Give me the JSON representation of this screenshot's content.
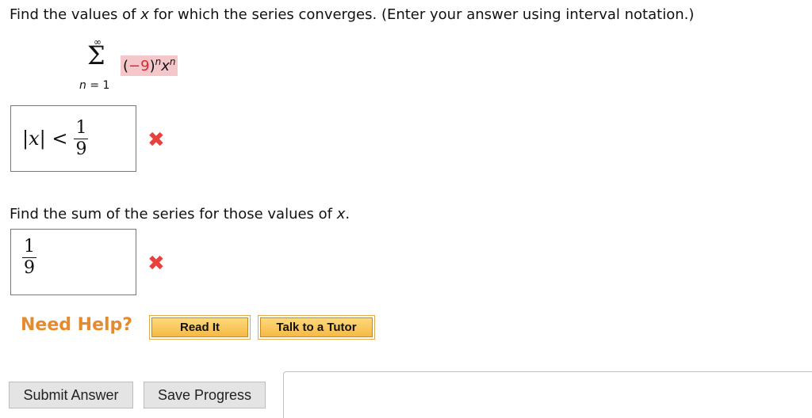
{
  "question1": {
    "text_before_var": "Find the values of ",
    "var": "x",
    "text_after_var": " for which the series converges. (Enter your answer using interval notation.)"
  },
  "series": {
    "upper_limit": "∞",
    "sigma": "Σ",
    "lower_index_var": "n",
    "lower_index_rest": " = 1",
    "term_base_open": "(",
    "term_base_value": "−9",
    "term_base_close": ")",
    "term_exp1": "n",
    "term_var": "x",
    "term_exp2": "n"
  },
  "answer1": {
    "lhs": "|x| <",
    "numerator": "1",
    "denominator": "9",
    "status_icon": "wrong-icon"
  },
  "question2": {
    "text_before_var": "Find the sum of the series for those values of ",
    "var": "x",
    "text_after_var": "."
  },
  "answer2": {
    "numerator": "1",
    "denominator": "9",
    "status_icon": "wrong-icon"
  },
  "help": {
    "label": "Need Help?",
    "read_it": "Read It",
    "talk_to_tutor": "Talk to a Tutor"
  },
  "actions": {
    "submit": "Submit Answer",
    "save": "Save Progress"
  },
  "colors": {
    "wrong": "#e8413c",
    "highlight": "#f4c7cb",
    "need_help": "#e68a2e",
    "tutor_button": "#f5b946"
  }
}
